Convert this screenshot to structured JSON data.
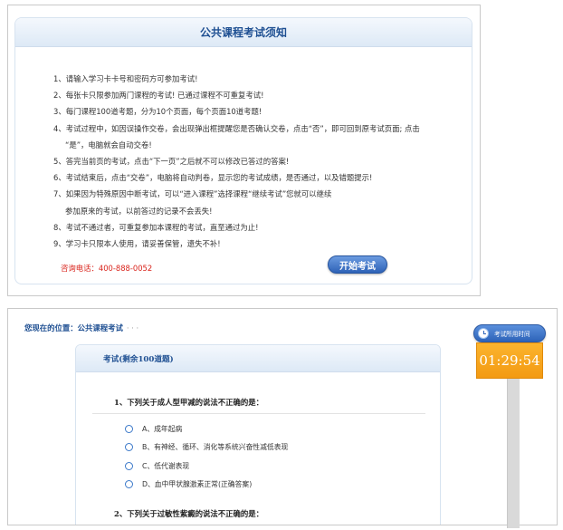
{
  "notice": {
    "title": "公共课程考试须知",
    "rules": [
      {
        "text": "1、请输入学习卡卡号和密码方可参加考试!"
      },
      {
        "text": "2、每张卡只限参加两门课程的考试! 已通过课程不可重复考试!"
      },
      {
        "text": "3、每门课程100道考题，分为10个页面，每个页面10道考题!"
      },
      {
        "text": "4、考试过程中，如因误操作交卷，会出现弹出框提醒您是否确认交卷，点击“否”，即可回到原考试页面; 点击",
        "cont": "“是”，电脑就会自动交卷!"
      },
      {
        "text": "5、答完当前页的考试，点击“下一页”之后就不可以修改已答过的答案!"
      },
      {
        "text": "6、考试结束后，点击“交卷”，电脑将自动判卷，显示您的考试成绩，是否通过，以及错题提示!"
      },
      {
        "text": "7、如果因为特殊原因中断考试，可以“进入课程”选择课程“继续考试”您就可以继续",
        "cont": "参加原来的考试，以前答过的记录不会丢失!"
      },
      {
        "text": "8、考试不通过者，可重复参加本课程的考试，直至通过为止!"
      },
      {
        "text": "9、学习卡只限本人使用，请妥善保管，遗失不补!"
      }
    ],
    "hotline": "咨询电话：400-888-0052",
    "start_button": "开始考试"
  },
  "exam": {
    "breadcrumb_label": "您现在的位置：",
    "breadcrumb_value": "公共课程考试",
    "breadcrumb_trail": "·  ·  ·",
    "title": "考试(剩余100道题)",
    "questions": [
      {
        "text": "1、下列关于成人型甲减的说法不正确的是：",
        "options": [
          "A、成年起病",
          "B、有神经、循环、消化等系统兴奋性减低表现",
          "C、低代谢表现",
          "D、血中甲状腺激素正常(正确答案)"
        ]
      },
      {
        "text": "2、下列关于过敏性紫癜的说法不正确的是：",
        "options": []
      }
    ]
  },
  "timer": {
    "label": "考试所用时间",
    "value": "01:29:54",
    "icon": "clock-icon"
  },
  "colors": {
    "title_blue": "#1e4f92",
    "hotline_red": "#d9231b",
    "timer_orange": "#f39a12",
    "button_blue": "#2e62b7"
  }
}
